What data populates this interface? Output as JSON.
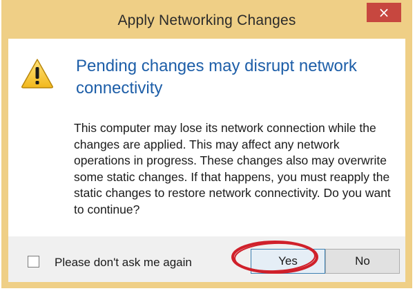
{
  "dialog": {
    "title": "Apply Networking Changes",
    "close_glyph": "×"
  },
  "content": {
    "icon": "warning-icon",
    "heading": "Pending changes may disrupt network connectivity",
    "message": "This computer may lose its network connection while the changes are applied. This may affect any network operations in progress. These changes also may overwrite some static changes. If that happens, you must reapply the static changes to restore network connectivity. Do you want to continue?"
  },
  "footer": {
    "checkbox_label": "Please don't ask me again",
    "checkbox_checked": false,
    "yes_label": "Yes",
    "no_label": "No"
  },
  "colors": {
    "frame": "#efcf86",
    "close": "#c7473f",
    "heading": "#1d5ea8",
    "annotation_ring": "#d0202a"
  }
}
